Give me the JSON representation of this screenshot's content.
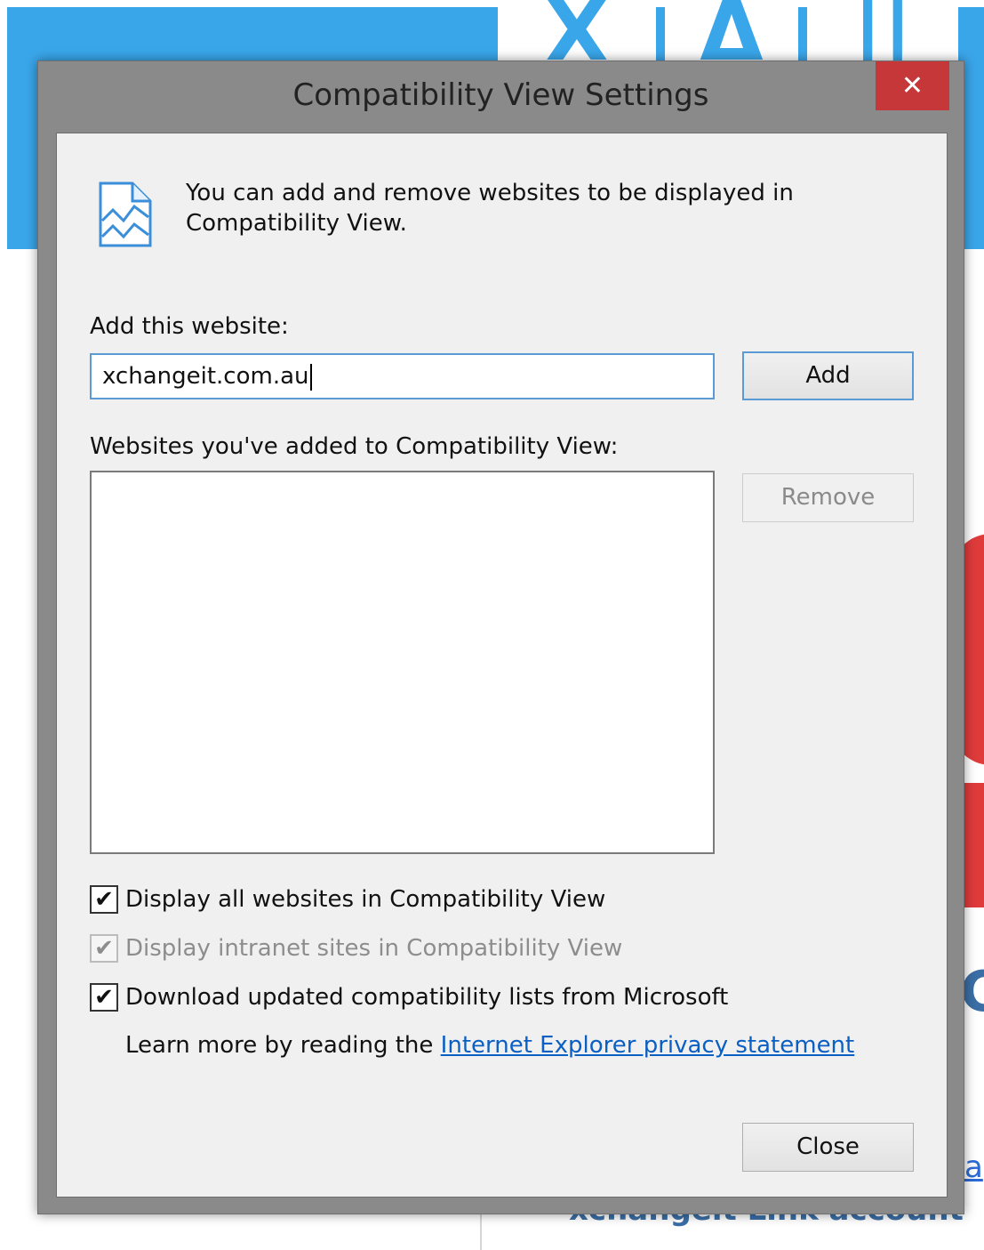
{
  "background": {
    "toolbar_glyphs": [
      "X",
      "Δ",
      "||"
    ],
    "partial_text_c": "C",
    "partial_text_a": "a",
    "partial_footer": "xchangeit Link account"
  },
  "dialog": {
    "title": "Compatibility View Settings",
    "close_glyph": "✕",
    "info_text": "You can add and remove websites to be displayed in Compatibility View.",
    "add_label": "Add this website:",
    "url_value": "xchangeit.com.au",
    "add_button": "Add",
    "list_label": "Websites you've added to Compatibility View:",
    "sites": [],
    "remove_button": "Remove",
    "options": [
      {
        "label": "Display all websites in Compatibility View",
        "checked": true,
        "enabled": true
      },
      {
        "label": "Display intranet sites in Compatibility View",
        "checked": true,
        "enabled": false
      },
      {
        "label": "Download updated compatibility lists from Microsoft",
        "checked": true,
        "enabled": true
      }
    ],
    "learn_more_prefix": "Learn more by reading the",
    "privacy_link": "Internet Explorer privacy statement",
    "close_button": "Close"
  },
  "colors": {
    "accent_blue": "#3aa6ea",
    "close_red": "#c6373a",
    "link": "#0b5fc2"
  }
}
